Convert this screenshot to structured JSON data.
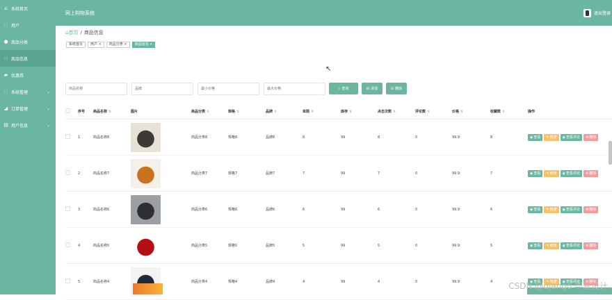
{
  "app": {
    "title": "网上购物系统",
    "logout_label": "退出登录"
  },
  "sidebar": {
    "items": [
      {
        "label": "系统首页",
        "icon": "home-icon",
        "glyph": "⌂"
      },
      {
        "label": "用户",
        "icon": "grid-icon",
        "glyph": "∷"
      },
      {
        "label": "商品分类",
        "icon": "location-icon",
        "glyph": "●"
      },
      {
        "label": "商品信息",
        "icon": "grid-icon",
        "glyph": "∷"
      },
      {
        "label": "优惠券",
        "icon": "ticket-icon",
        "glyph": "▰"
      },
      {
        "label": "系统管理",
        "icon": "grid-icon",
        "glyph": "∷",
        "caret": "⌄"
      },
      {
        "label": "订单管理",
        "icon": "cart-icon",
        "glyph": "◢",
        "caret": "⌄"
      },
      {
        "label": "用户信息",
        "icon": "card-icon",
        "glyph": "▤",
        "caret": "⌄"
      }
    ]
  },
  "breadcrumb": {
    "home": "首页",
    "separator": "/",
    "current": "商品信息"
  },
  "tags": [
    "系统首页",
    "用户 ×",
    "商品分类 ×",
    "商品信息 ×"
  ],
  "filters": {
    "placeholders": [
      "商品名称",
      "品牌",
      "最小价格",
      "最大价格"
    ],
    "search_label": "查询",
    "add_label": "添加",
    "delete_label": "删除"
  },
  "table": {
    "headers": [
      "序号",
      "商品名称",
      "图片",
      "商品分类",
      "规格",
      "品牌",
      "单限",
      "库存",
      "点击次数",
      "评论数",
      "价格",
      "收藏数",
      "操作"
    ],
    "rows": [
      {
        "idx": "1",
        "name": "商品名称8",
        "image": "dumplings-image",
        "category": "商品分类8",
        "spec": "规格8",
        "brand": "品牌8",
        "limit": "8",
        "stock": "99",
        "clicks": "8",
        "comments": "0",
        "price": "99.9",
        "fav": "8",
        "colors": [
          "#3c3a36",
          "#e8e1d7"
        ]
      },
      {
        "idx": "2",
        "name": "商品名称7",
        "image": "fried-chicken-image",
        "category": "商品分类7",
        "spec": "规格7",
        "brand": "品牌7",
        "limit": "7",
        "stock": "99",
        "clicks": "7",
        "comments": "0",
        "price": "99.9",
        "fav": "7",
        "colors": [
          "#c9731e",
          "#f5f1ea"
        ]
      },
      {
        "idx": "3",
        "name": "商品名称6",
        "image": "watch-image",
        "category": "商品分类6",
        "spec": "规格6",
        "brand": "品牌6",
        "limit": "6",
        "stock": "99",
        "clicks": "6",
        "comments": "0",
        "price": "99.9",
        "fav": "6",
        "colors": [
          "#2f2f33",
          "#9aa0a4"
        ]
      },
      {
        "idx": "4",
        "name": "商品名称5",
        "image": "apple-image",
        "category": "商品分类5",
        "spec": "规格5",
        "brand": "品牌5",
        "limit": "5",
        "stock": "99",
        "clicks": "5",
        "comments": "0",
        "price": "99.9",
        "fav": "5",
        "colors": [
          "#b50f16",
          "#ffffff"
        ]
      },
      {
        "idx": "5",
        "name": "商品名称4",
        "image": "laptop-image",
        "category": "商品分类4",
        "spec": "规格4",
        "brand": "品牌4",
        "limit": "4",
        "stock": "99",
        "clicks": "4",
        "comments": "0",
        "price": "99.9",
        "fav": "4",
        "colors": [
          "#1c2a3a",
          "#f3f3f3"
        ]
      }
    ],
    "ops": {
      "view": "查看",
      "edit": "修改",
      "comment": "查看评论",
      "delete": "删除"
    }
  },
  "watermark": "CSDN @django 毕业设计",
  "colors": {
    "primary": "#6bb6a0",
    "edit": "#f4c26a",
    "delete": "#f29b9b"
  }
}
